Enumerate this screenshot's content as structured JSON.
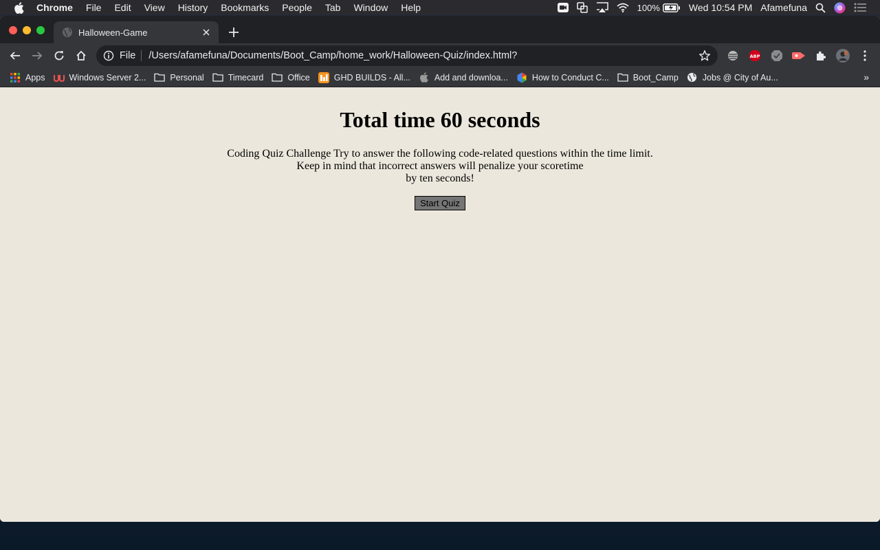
{
  "menubar": {
    "app": "Chrome",
    "items": [
      "File",
      "Edit",
      "View",
      "History",
      "Bookmarks",
      "People",
      "Tab",
      "Window",
      "Help"
    ],
    "battery": "100%",
    "clock": "Wed 10:54 PM",
    "user": "Afamefuna"
  },
  "browser": {
    "tab_title": "Halloween-Game",
    "scheme_label": "File",
    "url": "/Users/afamefuna/Documents/Boot_Camp/home_work/Halloween-Quiz/index.html?",
    "bookmarks": [
      {
        "label": "Apps",
        "icon": "apps-grid-icon"
      },
      {
        "label": "Windows Server 2...",
        "icon": "udemy-icon"
      },
      {
        "label": "Personal",
        "icon": "folder-icon"
      },
      {
        "label": "Timecard",
        "icon": "folder-icon"
      },
      {
        "label": "Office",
        "icon": "folder-icon"
      },
      {
        "label": "GHD BUILDS - All...",
        "icon": "ghd-icon"
      },
      {
        "label": "Add and downloa...",
        "icon": "apple-icon"
      },
      {
        "label": "How to Conduct C...",
        "icon": "hexagon-icon"
      },
      {
        "label": "Boot_Camp",
        "icon": "folder-icon"
      },
      {
        "label": "Jobs @ City of Au...",
        "icon": "globe-icon"
      }
    ],
    "bookmarks_more": "»"
  },
  "page": {
    "heading": "Total time 60 seconds",
    "intro_line1": "Coding Quiz Challenge Try to answer the following code-related questions within the time limit.",
    "intro_line2": "Keep in mind that incorrect answers will penalize your scoretime",
    "intro_line3": "by ten seconds!",
    "start_button": "Start Quiz"
  },
  "colors": {
    "page_background": "#ece7dc",
    "button_background": "#757575",
    "chrome_dark": "#35363a"
  }
}
